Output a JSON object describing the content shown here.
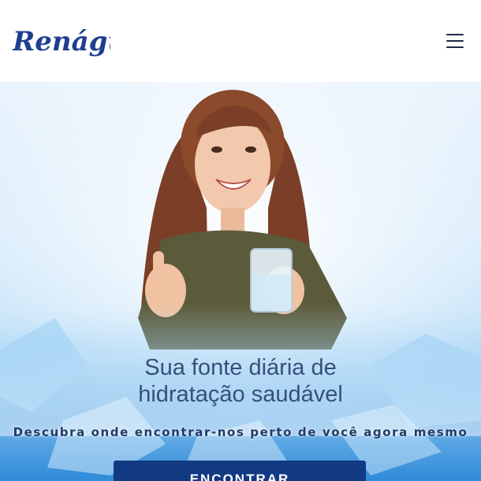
{
  "header": {
    "logo_text": "Renágua",
    "menu_icon": "hamburger-menu-icon"
  },
  "hero": {
    "title": "Sua fonte diária de hidratação saudável",
    "subtitle": "Descubra onde encontrar-nos perto de você agora mesmo",
    "cta_label": "ENCONTRAR"
  },
  "colors": {
    "brand_blue": "#123a82",
    "title_blue": "#35507a",
    "logo_blue": "#1c3f8f"
  }
}
